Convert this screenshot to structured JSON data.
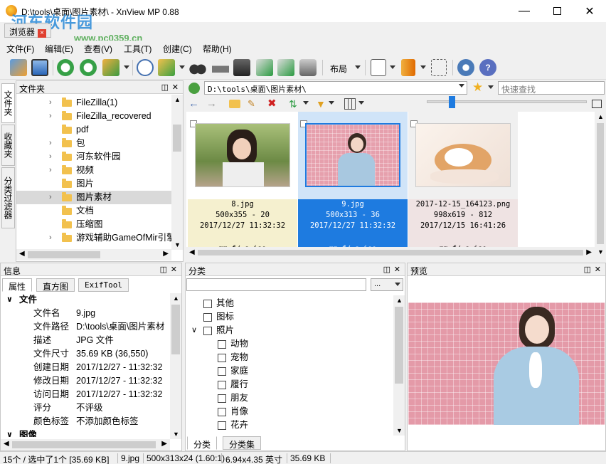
{
  "window": {
    "title": "D:\\tools\\桌面\\图片素材\\ - XnView MP 0.88",
    "subtab_label": "浏览器",
    "watermark": "河东软件园",
    "watermark_url": "www.pc0359.cn"
  },
  "menu": [
    "文件(F)",
    "编辑(E)",
    "查看(V)",
    "工具(T)",
    "创建(C)",
    "帮助(H)"
  ],
  "toolbar": {
    "layout_label": "布局",
    "icons": [
      "open-icon",
      "fullscreen-icon",
      "rotate-left-icon",
      "rotate-right-icon",
      "convert-icon",
      "info-icon",
      "move-icon",
      "binoculars-icon",
      "print-icon",
      "scanner-icon",
      "export-icon",
      "slideshow-icon",
      "camera-icon",
      "compare-icon",
      "bookmark-icon",
      "tree-icon",
      "settings-icon",
      "help-icon"
    ]
  },
  "vtabs": [
    "文件夹",
    "收藏夹",
    "分类过滤器"
  ],
  "folders": {
    "title": "文件夹",
    "items": [
      {
        "label": "FileZilla(1)",
        "chev": "›"
      },
      {
        "label": "FileZilla_recovered",
        "chev": "›"
      },
      {
        "label": "pdf",
        "chev": ""
      },
      {
        "label": "包",
        "chev": "›"
      },
      {
        "label": "河东软件园",
        "chev": "›"
      },
      {
        "label": "视频",
        "chev": "›"
      },
      {
        "label": "图片",
        "chev": ""
      },
      {
        "label": "图片素材",
        "chev": "›",
        "selected": true
      },
      {
        "label": "文档",
        "chev": ""
      },
      {
        "label": "压缩图",
        "chev": ""
      },
      {
        "label": "游戏辅助GameOfMir引擎",
        "chev": "›"
      }
    ]
  },
  "address": {
    "path": "D:\\tools\\桌面\\图片素材\\",
    "search_placeholder": "快速查找"
  },
  "thumbnails": [
    {
      "name": "8.jpg",
      "dims": "500x355 - 20",
      "date": "2017/12/27 11:32:32",
      "foot": "mm f/ s iso",
      "state": "normal",
      "bg": "#f5f0cf"
    },
    {
      "name": "9.jpg",
      "dims": "500x313 - 36",
      "date": "2017/12/27 11:32:32",
      "foot": "mm f/ s iso",
      "state": "selected",
      "bg": "#1e7be0"
    },
    {
      "name": "2017-12-15_164123.png",
      "dims": "998x619 - 812",
      "date": "2017/12/15 16:41:26",
      "foot": "mm f/ s iso",
      "state": "normal",
      "bg": "#efe3e3"
    }
  ],
  "info": {
    "title": "信息",
    "tabs": [
      "属性",
      "直方图",
      "ExifTool"
    ],
    "section": "文件",
    "section2": "图像",
    "rows": [
      {
        "k": "文件名",
        "v": "9.jpg"
      },
      {
        "k": "文件路径",
        "v": "D:\\tools\\桌面\\图片素材"
      },
      {
        "k": "描述",
        "v": "JPG 文件"
      },
      {
        "k": "文件尺寸",
        "v": "35.69 KB (36,550)"
      },
      {
        "k": "创建日期",
        "v": "2017/12/27 - 11:32:32"
      },
      {
        "k": "修改日期",
        "v": "2017/12/27 - 11:32:32"
      },
      {
        "k": "访问日期",
        "v": "2017/12/27 - 11:32:32"
      },
      {
        "k": "评分",
        "v": "不评级"
      },
      {
        "k": "颜色标签",
        "v": "不添加颜色标签"
      }
    ]
  },
  "categories": {
    "title": "分类",
    "dropdown_label": "...",
    "items": [
      {
        "label": "其他",
        "level": 0,
        "chev": ""
      },
      {
        "label": "图标",
        "level": 0,
        "chev": ""
      },
      {
        "label": "照片",
        "level": 0,
        "chev": "∨"
      },
      {
        "label": "动物",
        "level": 1,
        "chev": ""
      },
      {
        "label": "宠物",
        "level": 1,
        "chev": ""
      },
      {
        "label": "家庭",
        "level": 1,
        "chev": ""
      },
      {
        "label": "履行",
        "level": 1,
        "chev": ""
      },
      {
        "label": "朋友",
        "level": 1,
        "chev": ""
      },
      {
        "label": "肖像",
        "level": 1,
        "chev": ""
      },
      {
        "label": "花卉",
        "level": 1,
        "chev": ""
      }
    ],
    "tabs": [
      "分类",
      "分类集"
    ]
  },
  "preview": {
    "title": "预览"
  },
  "status": {
    "count": "15个 / 选中了1个 [35.69 KB]",
    "file": "9.jpg",
    "dims": "500x313x24 (1.60:1)",
    "inches": "6.94x4.35 英寸",
    "size": "35.69 KB"
  },
  "colors": {
    "accent": "#1e7be0",
    "selected_row": "#d9d9d9"
  }
}
